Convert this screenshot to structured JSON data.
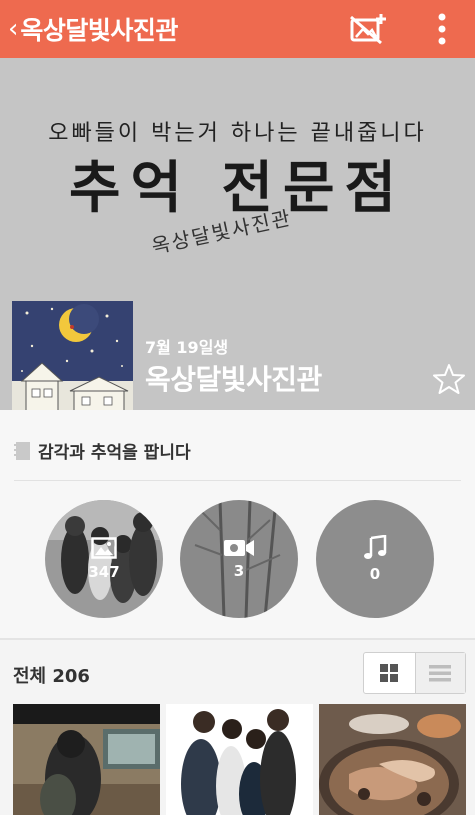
{
  "header": {
    "title": "옥상달빛사진관",
    "back_icon": "chevron-left-icon",
    "icons": [
      "no-photo-add-icon",
      "more-vert-icon"
    ],
    "color": "#ee6a4f"
  },
  "cover": {
    "line1": "오빠들이 박는거 하나는 끝내줍니다",
    "line2": "추억 전문점",
    "line3": "옥상달빛사진관"
  },
  "profile": {
    "birthday": "7월 19일생",
    "name": "옥상달빛사진관",
    "favorite_icon": "star-outline-icon"
  },
  "description": {
    "text": "감각과 추억을 팝니다"
  },
  "media": {
    "photos": "347",
    "videos": "3",
    "music": "0"
  },
  "list": {
    "total_label": "전체 206",
    "view_modes": [
      "grid-view-icon",
      "list-view-icon"
    ]
  }
}
